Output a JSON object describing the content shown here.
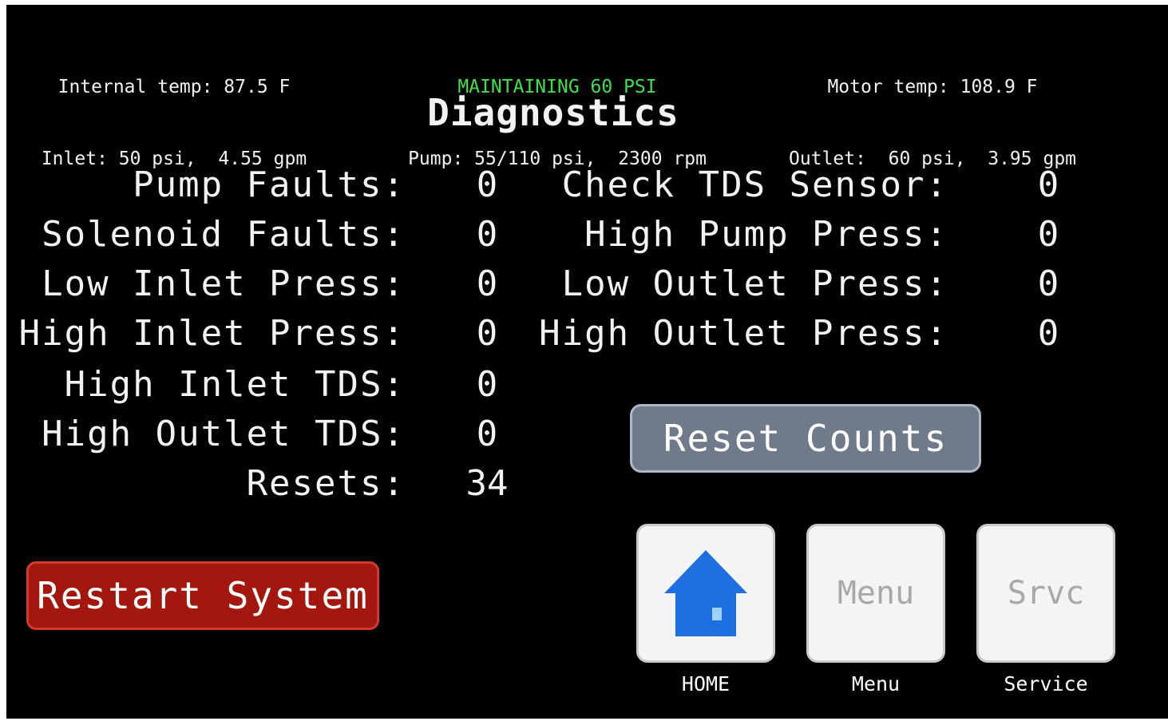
{
  "status": {
    "internal_temp": "Internal temp: 87.5 F",
    "inlet": "Inlet: 50 psi,  4.55 gpm",
    "mode": "MAINTAINING 60 PSI",
    "pump": "Pump: 55/110 psi,  2300 rpm",
    "motor_temp": "Motor temp: 108.9 F",
    "outlet": "Outlet:  60 psi,  3.95 gpm",
    "mode_color": "#3fe04a"
  },
  "title": "Diagnostics",
  "left_counters": [
    {
      "label": "Pump Faults:",
      "value": "0"
    },
    {
      "label": "Solenoid Faults:",
      "value": "0"
    },
    {
      "label": "Low Inlet Press:",
      "value": "0"
    },
    {
      "label": "High Inlet Press:",
      "value": "0"
    },
    {
      "label": "High Inlet TDS:",
      "value": "0"
    },
    {
      "label": "High Outlet TDS:",
      "value": "0"
    },
    {
      "label": "Resets:",
      "value": "34"
    }
  ],
  "right_counters": [
    {
      "label": "Check TDS Sensor:",
      "value": "0"
    },
    {
      "label": "High Pump Press:",
      "value": "0"
    },
    {
      "label": "Low Outlet Press:",
      "value": "0"
    },
    {
      "label": "High Outlet Press:",
      "value": "0"
    }
  ],
  "buttons": {
    "reset_counts": "Reset Counts",
    "restart_system": "Restart System",
    "restart_color": "#a3170f",
    "reset_color": "#6f7a8a"
  },
  "nav": {
    "home_icon": "house-icon",
    "home_label": "HOME",
    "menu_text": "Menu",
    "menu_label": "Menu",
    "service_text": "Srvc",
    "service_label": "Service",
    "home_icon_color": "#1e6fe0"
  }
}
